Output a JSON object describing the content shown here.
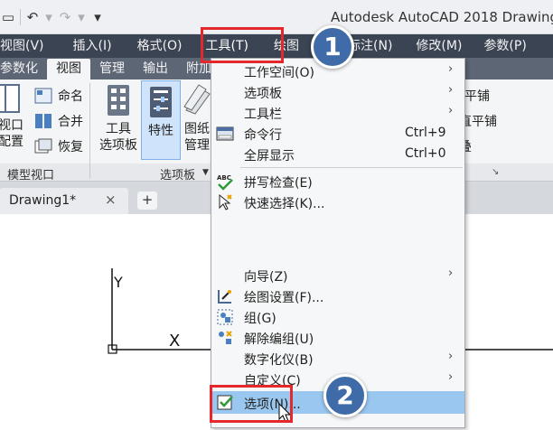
{
  "window": {
    "title": "Autodesk AutoCAD 2018    Drawing"
  },
  "menubar": {
    "items": [
      "视图(V)",
      "插入(I)",
      "格式(O)",
      "工具(T)",
      "绘图",
      "标注(N)",
      "修改(M)",
      "参数(P)"
    ]
  },
  "ribbon": {
    "tabs": [
      "参数化",
      "视图",
      "管理",
      "输出",
      "附加"
    ],
    "buttons": {
      "viewport_big": "视口",
      "viewport_big2": "配置",
      "named": "命名",
      "merge": "合并",
      "restore": "恢复",
      "tools1": "工具",
      "tools2": "选项板",
      "properties": "特性",
      "sheet1": "图纸",
      "sheet2": "管理",
      "tile1": "平铺",
      "tile2": "直平铺",
      "tile3": "叠"
    },
    "panels": {
      "model_viewports": "模型视口",
      "palettes": "选项板"
    }
  },
  "doc_tabs": {
    "active": "Drawing1*",
    "close": "×",
    "new": "+"
  },
  "canvas": {
    "y_axis": "Y",
    "x_mark": "X"
  },
  "tools_menu": {
    "items": [
      {
        "label": "工作空间(O)",
        "shortcut": "",
        "submenu": true,
        "icon": ""
      },
      {
        "label": "选项板",
        "shortcut": "",
        "submenu": true,
        "icon": ""
      },
      {
        "label": "工具栏",
        "shortcut": "",
        "submenu": true,
        "icon": ""
      },
      {
        "label": "命令行",
        "shortcut": "Ctrl+9",
        "submenu": false,
        "icon": "command-line-icon"
      },
      {
        "label": "全屏显示",
        "shortcut": "Ctrl+0",
        "submenu": false,
        "icon": ""
      },
      {
        "label": "拼写检查(E)",
        "shortcut": "",
        "submenu": false,
        "icon": "spell-check-icon",
        "icon_text": "ABC"
      },
      {
        "label": "快速选择(K)...",
        "shortcut": "",
        "submenu": false,
        "icon": "quick-select-icon"
      },
      {
        "label": "向导(Z)",
        "shortcut": "",
        "submenu": true,
        "icon": ""
      },
      {
        "label": "绘图设置(F)...",
        "shortcut": "",
        "submenu": false,
        "icon": "drafting-settings-icon"
      },
      {
        "label": "组(G)",
        "shortcut": "",
        "submenu": false,
        "icon": "group-icon"
      },
      {
        "label": "解除编组(U)",
        "shortcut": "",
        "submenu": false,
        "icon": "ungroup-icon"
      },
      {
        "label": "数字化仪(B)",
        "shortcut": "",
        "submenu": true,
        "icon": ""
      },
      {
        "label": "自定义(C)",
        "shortcut": "",
        "submenu": true,
        "icon": ""
      },
      {
        "label": "选项(N)...",
        "shortcut": "",
        "submenu": false,
        "icon": "options-icon"
      }
    ]
  },
  "callouts": {
    "step1": "1",
    "step2": "2"
  },
  "colors": {
    "menubar": "#3b4453",
    "highlight": "#99c7f0",
    "callout_border": "#e4282b",
    "badge": "#3f6ca8"
  }
}
